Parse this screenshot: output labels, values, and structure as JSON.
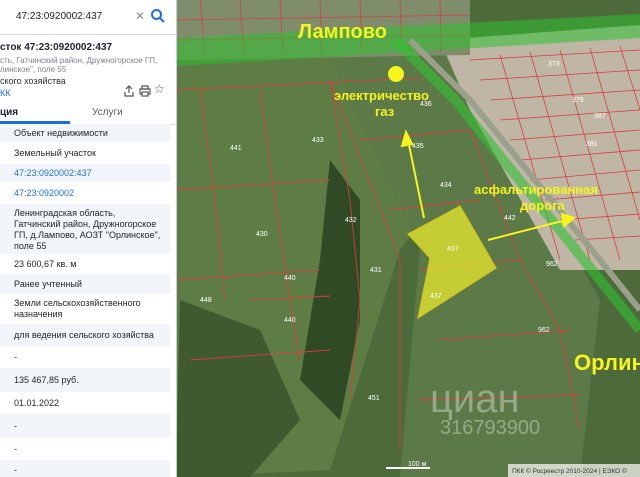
{
  "search": {
    "value": "47:23:0920002:437"
  },
  "card": {
    "title": "сток 47:23:0920002:437",
    "address_line1": "сть, Гатчинский район, Дружногорское ГП,",
    "address_line2": "линское\", поле 55",
    "category": "ского хозяйства",
    "kk_link": "КК"
  },
  "tabs": {
    "info": "ция",
    "services": "Услуги"
  },
  "info_rows": [
    "Объект недвижимости",
    "Земельный участок",
    "47:23:0920002:437",
    "47:23:0920002",
    "Ленинградская область,",
    "Гатчинский район, Дружногорское",
    "ГП, д.Лампово, АОЗТ \"Орлинское\",",
    "поле 55",
    "23 600,67 кв. м",
    "Ранее учтенный",
    "Земли сельскохозяйственного",
    "назначения",
    "для ведения сельского хозяйства",
    "-",
    "135 467,85 руб.",
    "01.01.2022",
    "-",
    "-",
    "-"
  ],
  "map": {
    "village_top": "Лампово",
    "village_right": "Орлин",
    "note_utilities_1": "электричество",
    "note_utilities_2": "газ",
    "note_road_1": "асфальтированная",
    "note_road_2": "дорога",
    "watermark_1": "циан",
    "watermark_2": "316793900",
    "scale": "100 м",
    "attribution": "ПКК © Росреестр 2010-2024 | ЕЭКО ©",
    "parcel_labels": [
      "441",
      "433",
      "435",
      "436",
      "434",
      "432",
      "430",
      "440",
      "431",
      "440",
      "448",
      "437",
      "437",
      "442",
      "962",
      "962",
      "451",
      "373",
      "379",
      "387",
      "381"
    ],
    "colors": {
      "highlight": "#e7ea2e",
      "annotation": "#f6f51c",
      "village": "#18b318",
      "boundary": "#cf3a3a"
    }
  },
  "icons": {
    "clear": "close-icon",
    "search": "search-icon",
    "share": "share-icon",
    "print": "print-icon",
    "favorite": "star-icon"
  }
}
